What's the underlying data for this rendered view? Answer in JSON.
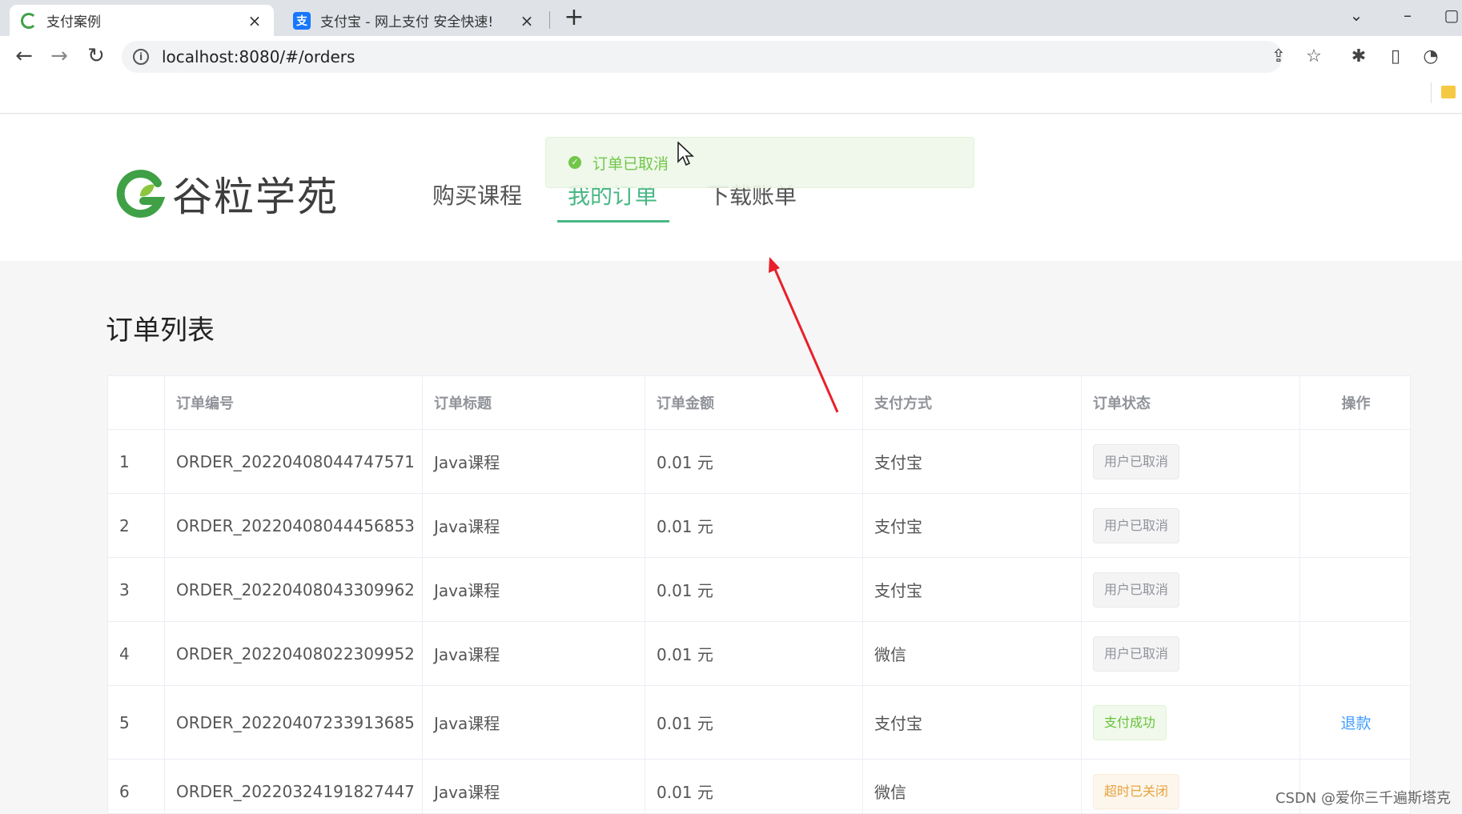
{
  "browser": {
    "tabs": [
      {
        "title": "支付案例",
        "close": "×"
      },
      {
        "title": "支付宝 - 网上支付 安全快速!",
        "close": "×"
      }
    ],
    "new_tab": "+",
    "url": "localhost:8080/#/orders"
  },
  "site": {
    "logo_text": "谷粒学苑",
    "nav": [
      {
        "label": "购买课程"
      },
      {
        "label": "我的订单"
      },
      {
        "label": "下载账单"
      }
    ]
  },
  "toast": {
    "message": "订单已取消",
    "icon": "check-circle-icon",
    "color": "#67c23a"
  },
  "orders": {
    "title": "订单列表",
    "columns": [
      "",
      "订单编号",
      "订单标题",
      "订单金额",
      "支付方式",
      "订单状态",
      "操作"
    ],
    "rows": [
      {
        "index": "1",
        "order_no": "ORDER_20220408044747571",
        "title": "Java课程",
        "amount": "0.01 元",
        "pay_type": "支付宝",
        "status": "用户已取消",
        "status_type": "info",
        "action": ""
      },
      {
        "index": "2",
        "order_no": "ORDER_20220408044456853",
        "title": "Java课程",
        "amount": "0.01 元",
        "pay_type": "支付宝",
        "status": "用户已取消",
        "status_type": "info",
        "action": ""
      },
      {
        "index": "3",
        "order_no": "ORDER_20220408043309962",
        "title": "Java课程",
        "amount": "0.01 元",
        "pay_type": "支付宝",
        "status": "用户已取消",
        "status_type": "info",
        "action": ""
      },
      {
        "index": "4",
        "order_no": "ORDER_20220408022309952",
        "title": "Java课程",
        "amount": "0.01 元",
        "pay_type": "微信",
        "status": "用户已取消",
        "status_type": "info",
        "action": ""
      },
      {
        "index": "5",
        "order_no": "ORDER_20220407233913685",
        "title": "Java课程",
        "amount": "0.01 元",
        "pay_type": "支付宝",
        "status": "支付成功",
        "status_type": "success",
        "action": "退款"
      },
      {
        "index": "6",
        "order_no": "ORDER_20220324191827447",
        "title": "Java课程",
        "amount": "0.01 元",
        "pay_type": "微信",
        "status": "超时已关闭",
        "status_type": "warning",
        "action": ""
      }
    ]
  },
  "colors": {
    "accent": "#48b784",
    "link": "#409eff",
    "annotation_arrow": "#e8202a"
  },
  "watermark": "CSDN @爱你三千遍斯塔克"
}
